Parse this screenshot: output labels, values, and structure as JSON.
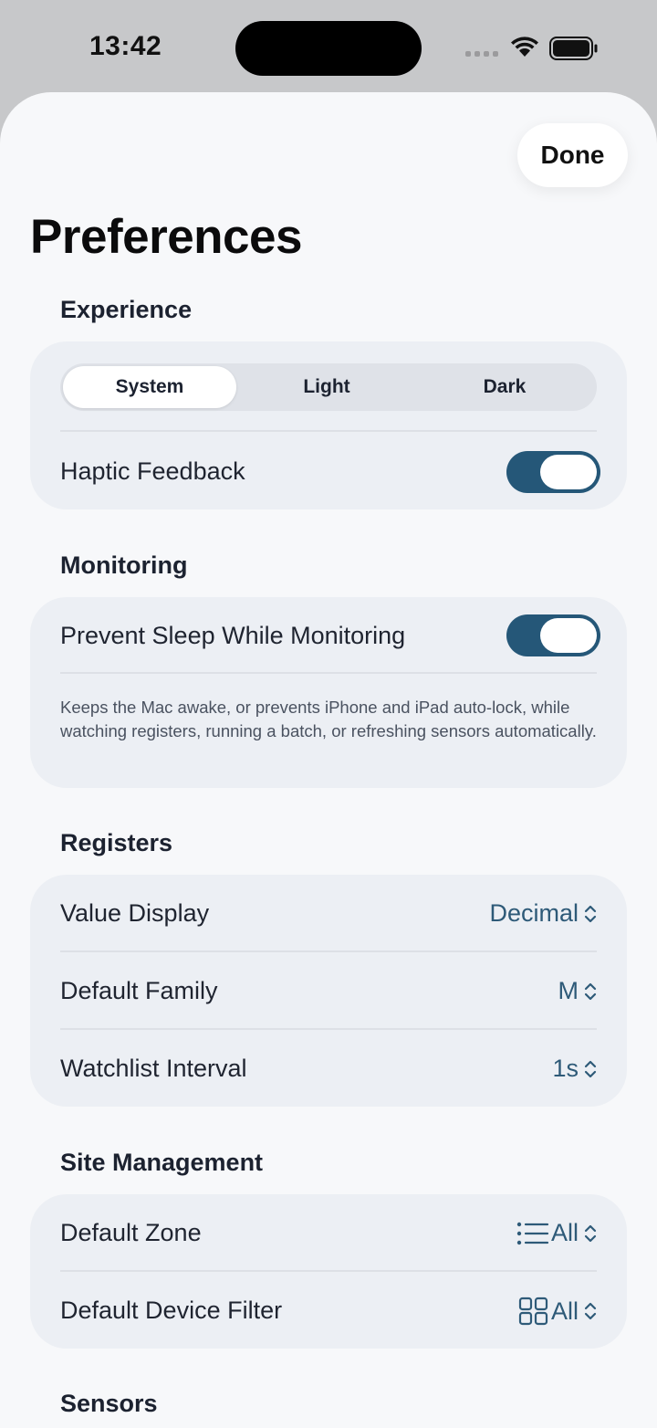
{
  "status": {
    "time": "13:42"
  },
  "header": {
    "done_label": "Done",
    "title": "Preferences"
  },
  "sections": {
    "experience": {
      "title": "Experience",
      "appearance_options": [
        "System",
        "Light",
        "Dark"
      ],
      "appearance_selected": "System",
      "haptic_label": "Haptic Feedback",
      "haptic_on": true
    },
    "monitoring": {
      "title": "Monitoring",
      "prevent_sleep_label": "Prevent Sleep While Monitoring",
      "prevent_sleep_on": true,
      "footnote": "Keeps the Mac awake, or prevents iPhone and iPad auto-lock, while watching registers, running a batch, or refreshing sensors automatically."
    },
    "registers": {
      "title": "Registers",
      "rows": [
        {
          "label": "Value Display",
          "value": "Decimal"
        },
        {
          "label": "Default Family",
          "value": "M"
        },
        {
          "label": "Watchlist Interval",
          "value": "1s"
        }
      ]
    },
    "site_management": {
      "title": "Site Management",
      "rows": [
        {
          "label": "Default Zone",
          "value": "All",
          "icon": "list-icon"
        },
        {
          "label": "Default Device Filter",
          "value": "All",
          "icon": "grid-icon"
        }
      ]
    },
    "sensors": {
      "title": "Sensors"
    }
  },
  "colors": {
    "accent": "#255778",
    "value_text": "#2e5a78",
    "card": "#eceff4",
    "sheet": "#f7f8fa"
  }
}
